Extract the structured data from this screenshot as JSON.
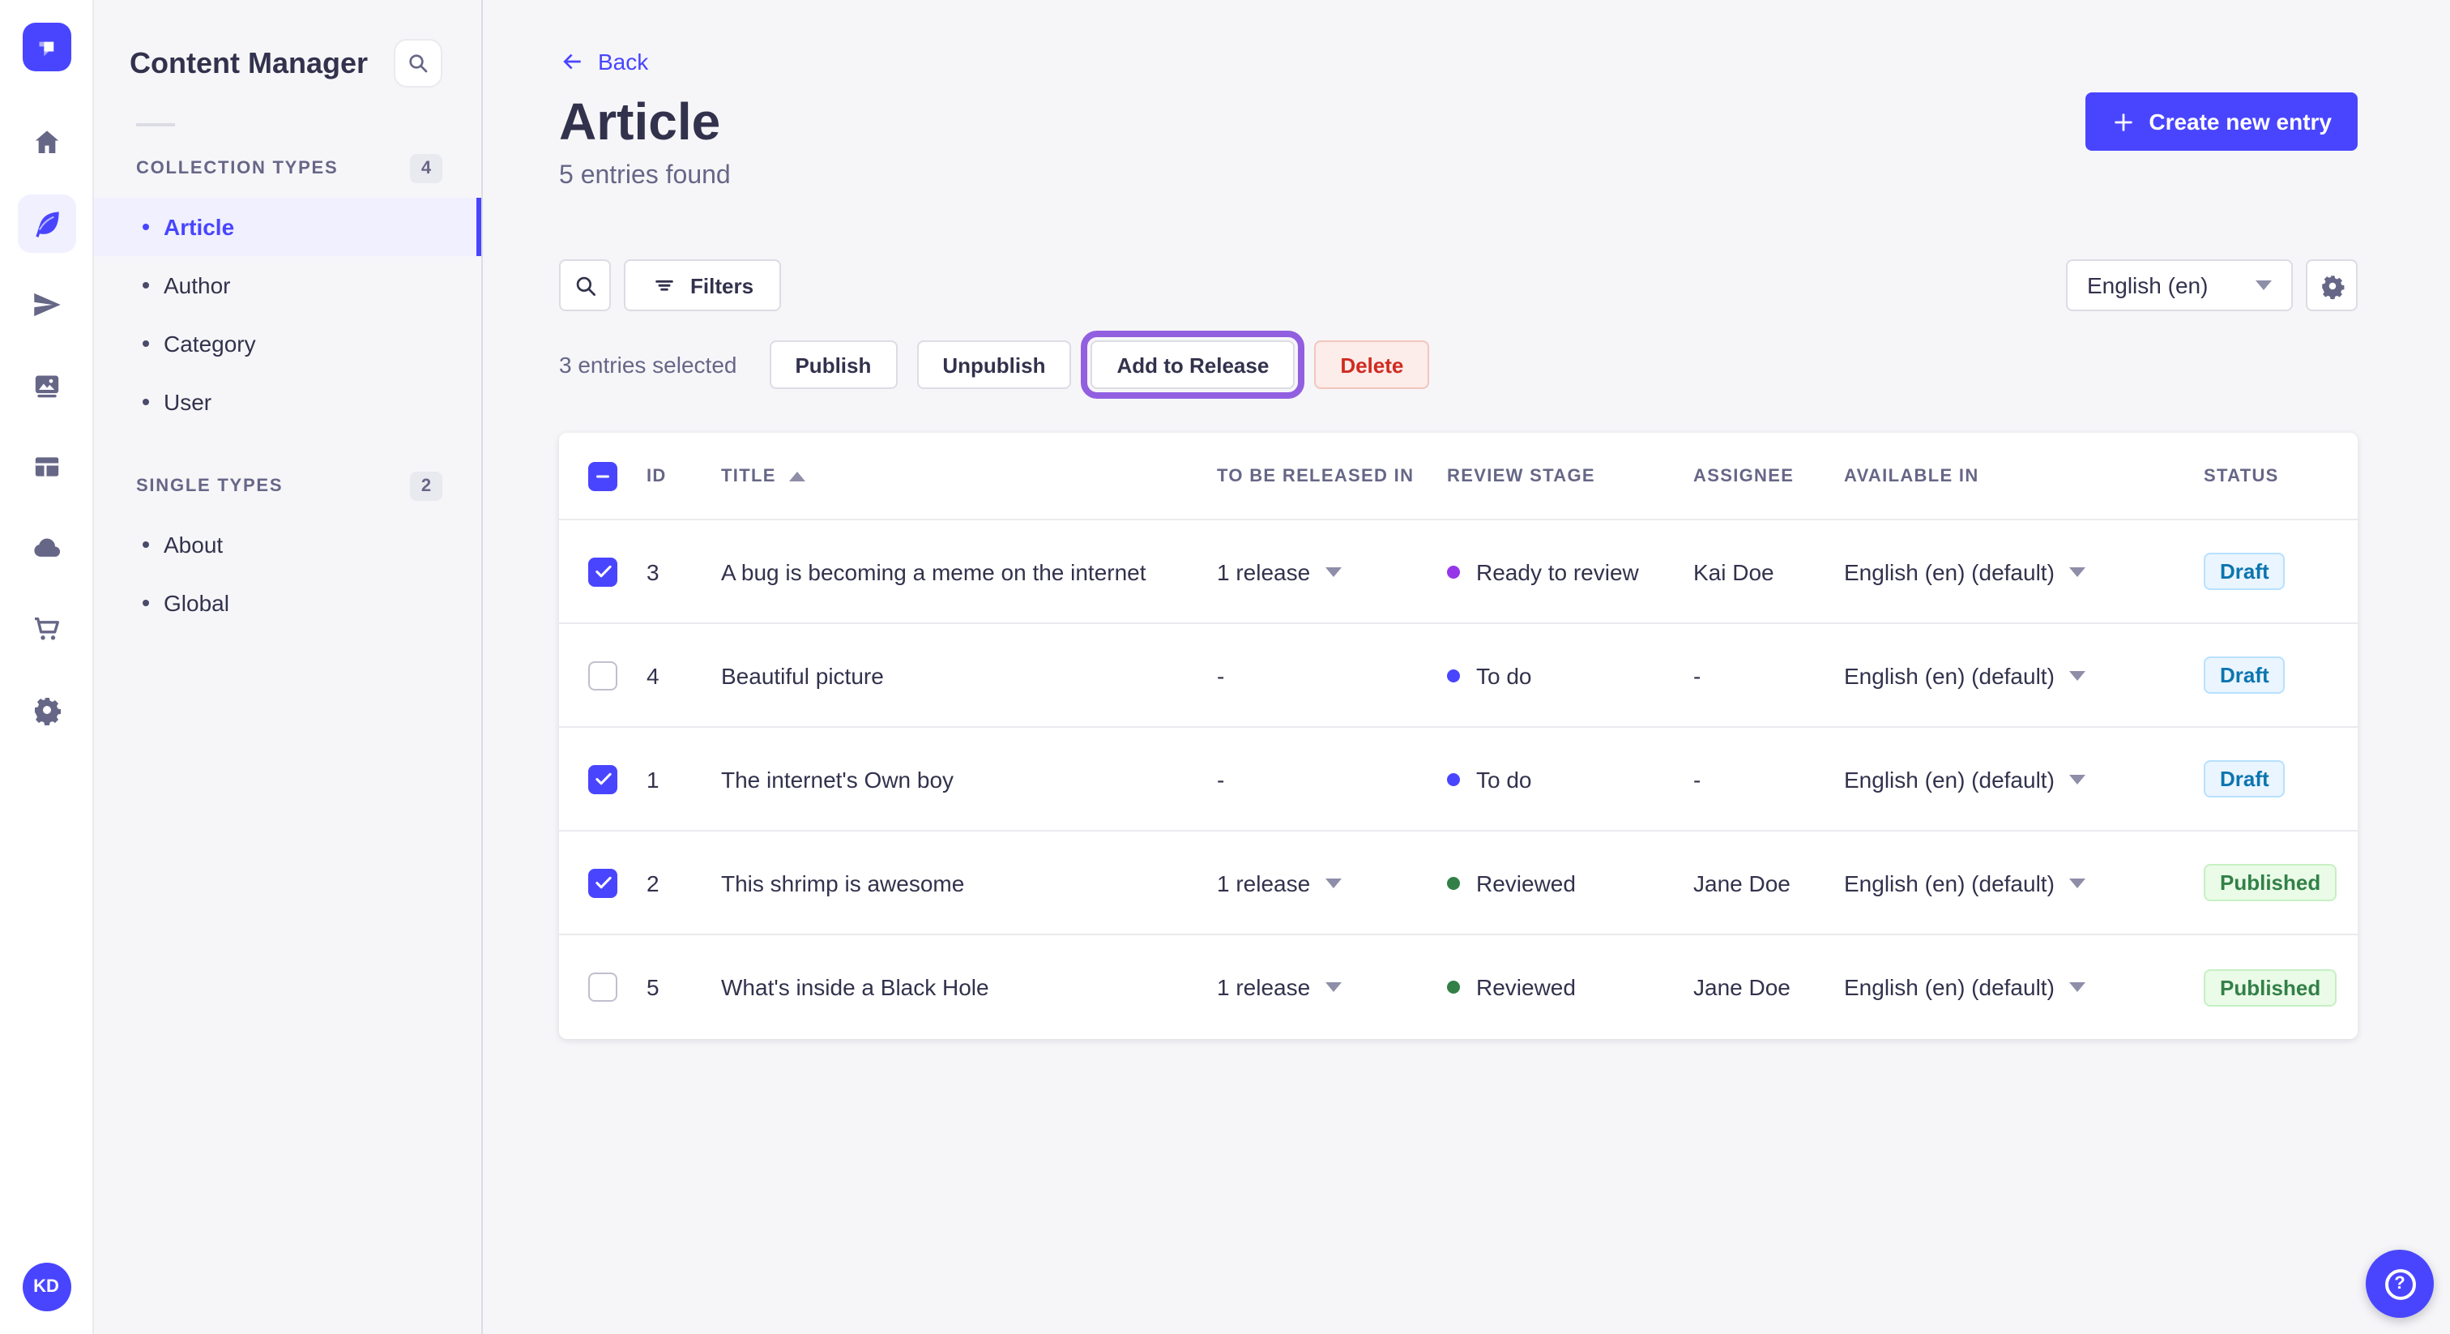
{
  "colors": {
    "primary": "#4945ff",
    "active_bg": "#f0f0ff",
    "highlight_ring": "#915fe0",
    "stage_to_do": "#4945ff",
    "stage_ready_to_review": "#9736e8",
    "stage_reviewed": "#328048",
    "draft_text": "#0c75af",
    "published_text": "#328048",
    "delete_text": "#d02b20"
  },
  "rail": {
    "icons": [
      "strapi-logo",
      "home",
      "content-manager",
      "releases",
      "media-library",
      "content-type-builder",
      "cloud",
      "marketplace",
      "settings"
    ],
    "active_icon": "content-manager",
    "avatar_initials": "KD"
  },
  "subnav": {
    "title": "Content Manager",
    "sections": [
      {
        "label": "COLLECTION TYPES",
        "count": "4",
        "items": [
          {
            "label": "Article",
            "active": true
          },
          {
            "label": "Author",
            "active": false
          },
          {
            "label": "Category",
            "active": false
          },
          {
            "label": "User",
            "active": false
          }
        ]
      },
      {
        "label": "SINGLE TYPES",
        "count": "2",
        "items": [
          {
            "label": "About",
            "active": false
          },
          {
            "label": "Global",
            "active": false
          }
        ]
      }
    ]
  },
  "header": {
    "back": "Back",
    "title": "Article",
    "subtitle": "5 entries found",
    "create": "Create new entry"
  },
  "toolbar": {
    "filters": "Filters",
    "locale": "English (en)"
  },
  "selection": {
    "text": "3 entries selected",
    "publish": "Publish",
    "unpublish": "Unpublish",
    "add_to_release": "Add to Release",
    "delete": "Delete"
  },
  "table": {
    "columns": [
      "ID",
      "TITLE",
      "TO BE RELEASED IN",
      "REVIEW STAGE",
      "ASSIGNEE",
      "AVAILABLE IN",
      "STATUS"
    ],
    "rows": [
      {
        "checked": true,
        "id": "3",
        "title": "A bug is becoming a meme on the internet",
        "release": "1 release",
        "release_menu": true,
        "stage": "Ready to review",
        "stage_color": "#9736e8",
        "assignee": "Kai Doe",
        "locale": "English (en) (default)",
        "status": "Draft"
      },
      {
        "checked": false,
        "id": "4",
        "title": "Beautiful picture",
        "release": "-",
        "release_menu": false,
        "stage": "To do",
        "stage_color": "#4945ff",
        "assignee": "-",
        "locale": "English (en) (default)",
        "status": "Draft"
      },
      {
        "checked": true,
        "id": "1",
        "title": "The internet's Own boy",
        "release": "-",
        "release_menu": false,
        "stage": "To do",
        "stage_color": "#4945ff",
        "assignee": "-",
        "locale": "English (en) (default)",
        "status": "Draft"
      },
      {
        "checked": true,
        "id": "2",
        "title": "This shrimp is awesome",
        "release": "1 release",
        "release_menu": true,
        "stage": "Reviewed",
        "stage_color": "#328048",
        "assignee": "Jane Doe",
        "locale": "English (en) (default)",
        "status": "Published"
      },
      {
        "checked": false,
        "id": "5",
        "title": "What's inside a Black Hole",
        "release": "1 release",
        "release_menu": true,
        "stage": "Reviewed",
        "stage_color": "#328048",
        "assignee": "Jane Doe",
        "locale": "English (en) (default)",
        "status": "Published"
      }
    ]
  },
  "help": {
    "label": "?"
  }
}
